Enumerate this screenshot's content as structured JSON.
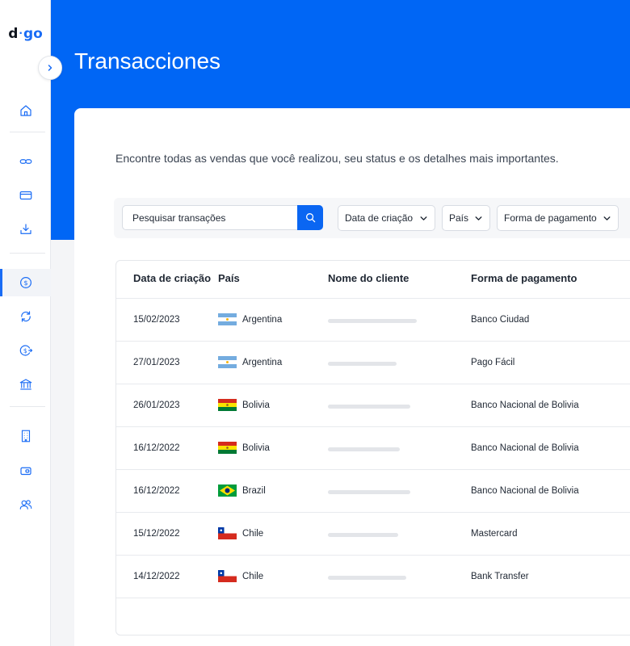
{
  "brand": {
    "logo_d": "d",
    "logo_dot": "·",
    "logo_go": "go"
  },
  "header": {
    "title": "Transacciones"
  },
  "main": {
    "description": "Encontre todas as vendas que você realizou, seu status e os detalhes mais importantes."
  },
  "filters": {
    "search_placeholder": "Pesquisar transações",
    "date_label": "Data de criação",
    "country_label": "País",
    "payment_label": "Forma de pagamento"
  },
  "table": {
    "columns": [
      "Data de criação",
      "País",
      "Nome do cliente",
      "Forma de pagamento"
    ],
    "rows": [
      {
        "date": "15/02/2023",
        "country": "Argentina",
        "flag": "argentina-flag-icon",
        "client_redacted_fraction": 1.0,
        "payment": "Banco Ciudad"
      },
      {
        "date": "27/01/2023",
        "country": "Argentina",
        "flag": "argentina-flag-icon",
        "client_redacted_fraction": 0.77,
        "payment": "Pago Fácil"
      },
      {
        "date": "26/01/2023",
        "country": "Bolivia",
        "flag": "bolivia-flag-icon",
        "client_redacted_fraction": 0.93,
        "payment": "Banco Nacional de Bolivia"
      },
      {
        "date": "16/12/2022",
        "country": "Bolivia",
        "flag": "bolivia-flag-icon",
        "client_redacted_fraction": 0.81,
        "payment": "Banco Nacional de Bolivia"
      },
      {
        "date": "16/12/2022",
        "country": "Brazil",
        "flag": "brazil-flag-icon",
        "client_redacted_fraction": 0.93,
        "payment": "Banco Nacional de Bolivia"
      },
      {
        "date": "15/12/2022",
        "country": "Chile",
        "flag": "chile-flag-icon",
        "client_redacted_fraction": 0.79,
        "payment": "Mastercard"
      },
      {
        "date": "14/12/2022",
        "country": "Chile",
        "flag": "chile-flag-icon",
        "client_redacted_fraction": 0.88,
        "payment": "Bank Transfer"
      }
    ]
  },
  "sidebar": {
    "icons": [
      "home-icon",
      "link-icon",
      "card-icon",
      "download-icon",
      "dollar-circle-icon",
      "refresh-icon",
      "dollar-out-icon",
      "bank-icon",
      "building-icon",
      "wallet-icon",
      "users-icon"
    ],
    "active": "dollar-circle-icon"
  },
  "colors": {
    "primary": "#0066f5",
    "accent": "#1a6cf5",
    "skeleton": "#e3e5e9"
  }
}
